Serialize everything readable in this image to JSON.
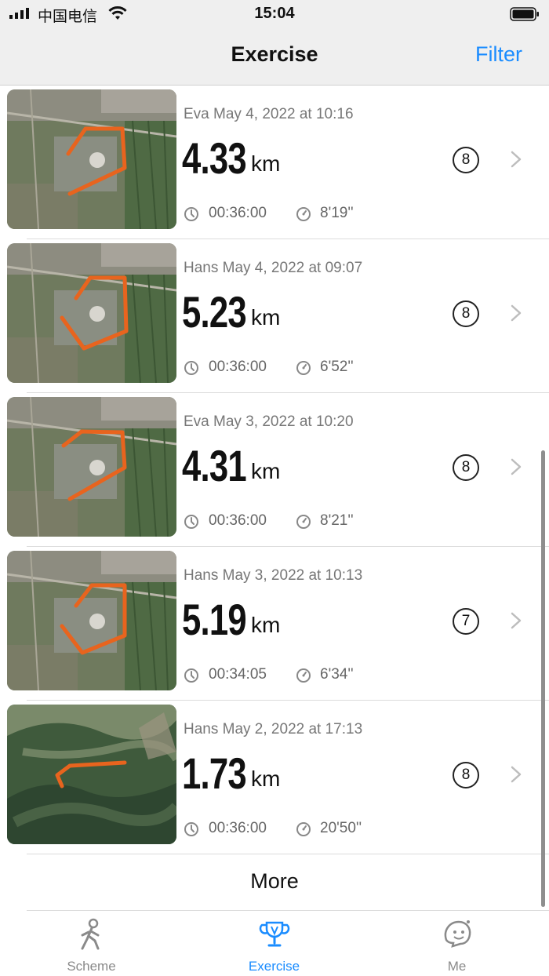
{
  "status_bar": {
    "carrier": "中国电信",
    "time": "15:04"
  },
  "nav": {
    "title": "Exercise",
    "filter_label": "Filter"
  },
  "exercises": [
    {
      "title": "Eva May 4, 2022 at 10:16",
      "distance": "4.33",
      "unit": "km",
      "count": "8",
      "duration": "00:36:00",
      "pace": "8'19''",
      "map": "city"
    },
    {
      "title": "Hans May 4, 2022 at 09:07",
      "distance": "5.23",
      "unit": "km",
      "count": "8",
      "duration": "00:36:00",
      "pace": "6'52''",
      "map": "city"
    },
    {
      "title": "Eva May 3, 2022 at 10:20",
      "distance": "4.31",
      "unit": "km",
      "count": "8",
      "duration": "00:36:00",
      "pace": "8'21''",
      "map": "city"
    },
    {
      "title": "Hans May 3, 2022 at 10:13",
      "distance": "5.19",
      "unit": "km",
      "count": "7",
      "duration": "00:34:05",
      "pace": "6'34''",
      "map": "city"
    },
    {
      "title": "Hans May 2, 2022 at 17:13",
      "distance": "1.73",
      "unit": "km",
      "count": "8",
      "duration": "00:36:00",
      "pace": "20'50''",
      "map": "mountain"
    }
  ],
  "more_label": "More",
  "tabs": [
    {
      "label": "Scheme",
      "icon": "runner-icon",
      "active": false
    },
    {
      "label": "Exercise",
      "icon": "trophy-icon",
      "active": true
    },
    {
      "label": "Me",
      "icon": "ghost-face-icon",
      "active": false
    }
  ],
  "colors": {
    "accent": "#1a8cff",
    "route": "#e8641e",
    "secondary_text": "#777777"
  }
}
